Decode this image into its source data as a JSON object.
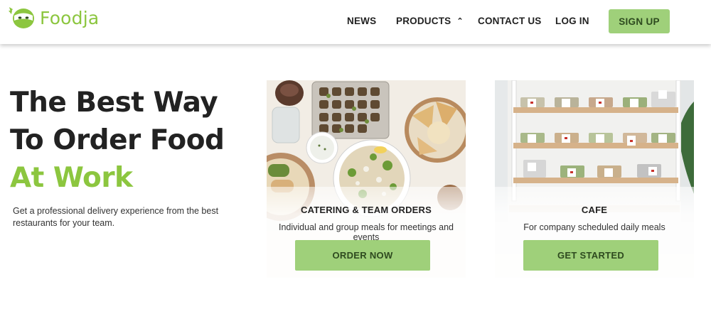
{
  "brand": {
    "name": "Foodja",
    "accent": "#8cc63f",
    "button_color": "#9fd07a"
  },
  "nav": {
    "items": [
      {
        "label": "NEWS"
      },
      {
        "label": "PRODUCTS",
        "icon": "caret-up"
      },
      {
        "label": "CONTACT US"
      },
      {
        "label": "LOG IN"
      }
    ],
    "signup_label": "SIGN UP"
  },
  "hero": {
    "line1": "The Best Way",
    "line2": "To Order Food",
    "line3": "At Work",
    "subtitle": "Get a professional delivery experience from the best restaurants for your team."
  },
  "cards": [
    {
      "title": "CATERING & TEAM ORDERS",
      "description": "Individual and group meals for meetings and events",
      "button": "ORDER NOW",
      "image": "catering-food-platter"
    },
    {
      "title": "CAFE",
      "description": "For company scheduled daily meals",
      "button": "GET STARTED",
      "image": "cafe-shelves"
    }
  ]
}
